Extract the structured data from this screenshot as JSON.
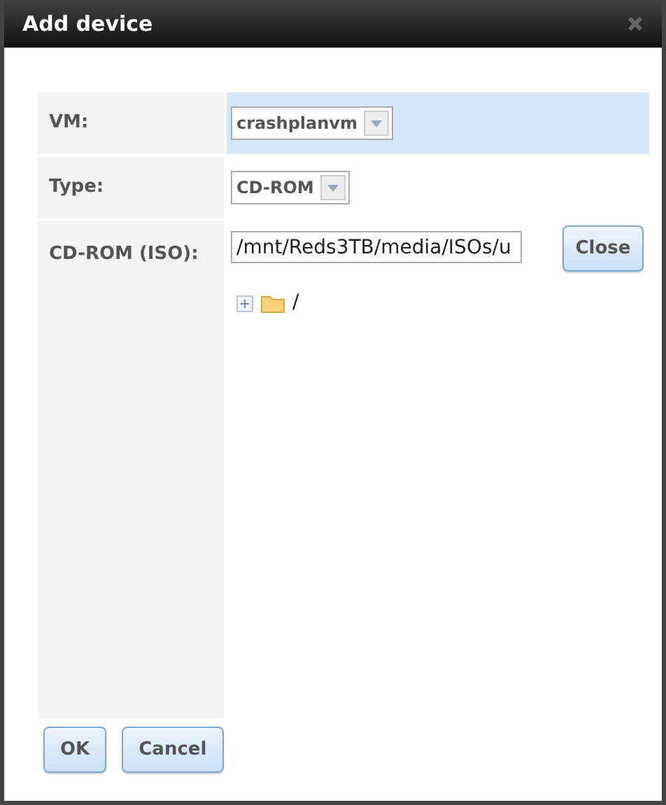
{
  "window": {
    "title": "Add device"
  },
  "rows": [
    {
      "kind": "select",
      "label": "VM:",
      "value": "crashplanvm",
      "highlighted": true
    },
    {
      "kind": "select",
      "label": "Type:",
      "value": "CD-ROM",
      "highlighted": false
    },
    {
      "kind": "path",
      "label": "CD-ROM (ISO):",
      "value": "/mnt/Reds3TB/media/ISOs/u",
      "highlighted": false,
      "button": "Close",
      "tree": [
        {
          "label": "/",
          "expanded": false
        }
      ]
    }
  ],
  "buttons": [
    "OK",
    "Cancel"
  ]
}
